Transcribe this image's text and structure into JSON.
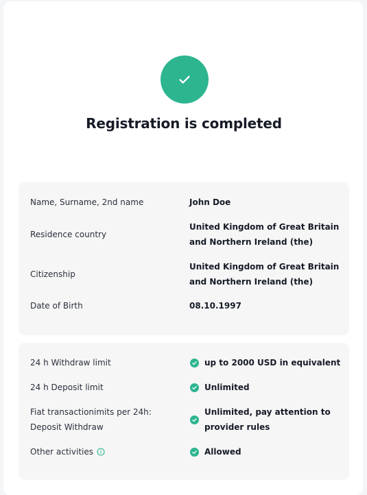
{
  "header": {
    "title": "Registration is completed",
    "icon": "check-icon",
    "accent_color": "#2db590"
  },
  "personal_info": [
    {
      "label": "Name, Surname, 2nd name",
      "value": "John Doe"
    },
    {
      "label": "Residence country",
      "value": "United Kingdom of Great Britain and Northern Ireland (the)"
    },
    {
      "label": "Citizenship",
      "value": "United Kingdom of Great Britain and Northern Ireland (the)"
    },
    {
      "label": "Date of Birth",
      "value": "08.10.1997"
    }
  ],
  "limits": [
    {
      "label": "24 h Withdraw limit",
      "value": "up to 2000 USD in equivalent",
      "icon": "check-circle-icon"
    },
    {
      "label": "24 h Deposit limit",
      "value": "Unlimited",
      "icon": "check-circle-icon"
    },
    {
      "label": "Fiat transactionimits per 24h: Deposit Withdraw",
      "value": "Unlimited, pay attention to provider rules",
      "icon": "check-circle-icon"
    },
    {
      "label": "Other activities",
      "value": "Allowed",
      "icon": "check-circle-icon",
      "label_icon": "info-icon"
    }
  ]
}
